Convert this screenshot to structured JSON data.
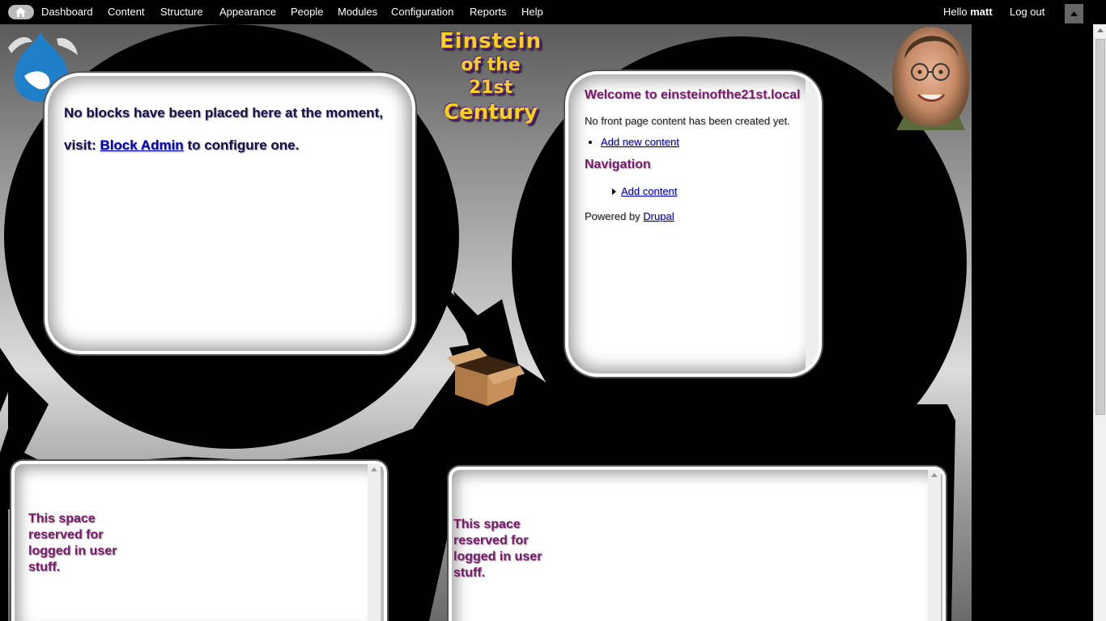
{
  "toolbar": {
    "home_icon": "home-icon",
    "items": [
      {
        "label": "Dashboard"
      },
      {
        "label": "Content"
      },
      {
        "label": "Structure"
      },
      {
        "label": "Appearance"
      },
      {
        "label": "People"
      },
      {
        "label": "Modules"
      },
      {
        "label": "Configuration"
      },
      {
        "label": "Reports"
      },
      {
        "label": "Help"
      }
    ],
    "hello_prefix": "Hello",
    "username": "matt",
    "logout": "Log out",
    "toggle_icon": "chevron-up-icon"
  },
  "logo": {
    "line1": "Einstein",
    "line2": "of the",
    "line3": "21st",
    "line4": "Century"
  },
  "left_block": {
    "text_before": "No blocks have been placed here at the moment, visit:",
    "link": "Block Admin",
    "text_after": "to configure one."
  },
  "right_block": {
    "welcome": "Welcome to einsteinofthe21st.local",
    "no_content": "No front page content has been created yet.",
    "add_new_content": "Add new content",
    "navigation_title": "Navigation",
    "add_content": "Add content",
    "powered_by": "Powered by",
    "drupal": "Drupal"
  },
  "bottom_left": {
    "text": "This space reserved for logged in user stuff."
  },
  "bottom_right": {
    "text": "This space reserved for logged in user stuff."
  },
  "colors": {
    "toolbar_bg": "#000000",
    "heading_purple": "#7a1a6c",
    "link_blue": "#0000b8",
    "drupal_blue": "#1f7fc8"
  }
}
